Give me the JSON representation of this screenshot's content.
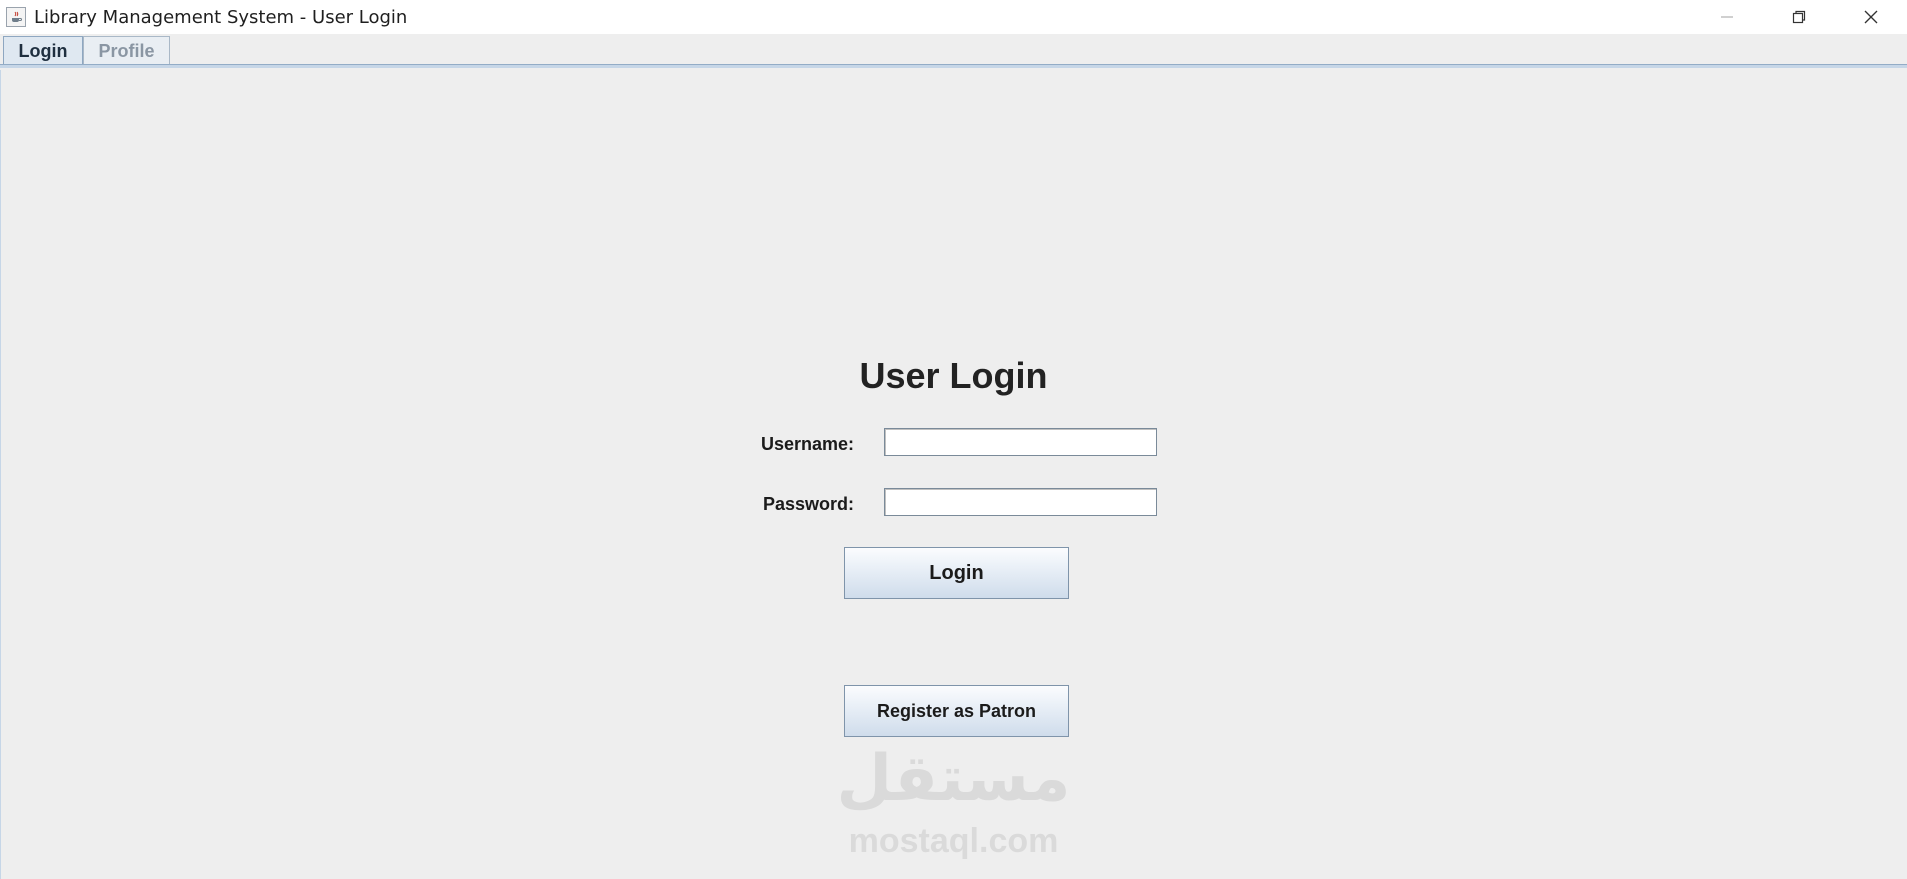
{
  "window": {
    "title": "Library Management System - User Login",
    "app_icon": "java-cup-icon",
    "controls": {
      "minimize": "minimize-icon",
      "restore": "restore-icon",
      "close": "close-icon"
    }
  },
  "tabs": [
    {
      "label": "Login",
      "selected": true
    },
    {
      "label": "Profile",
      "selected": false
    }
  ],
  "login_form": {
    "heading": "User Login",
    "username_label": "Username:",
    "username_value": "",
    "password_label": "Password:",
    "password_value": "",
    "login_button": "Login",
    "register_button": "Register as Patron"
  },
  "watermark": {
    "arabic": "مستقل",
    "site": "mostaql.com"
  }
}
